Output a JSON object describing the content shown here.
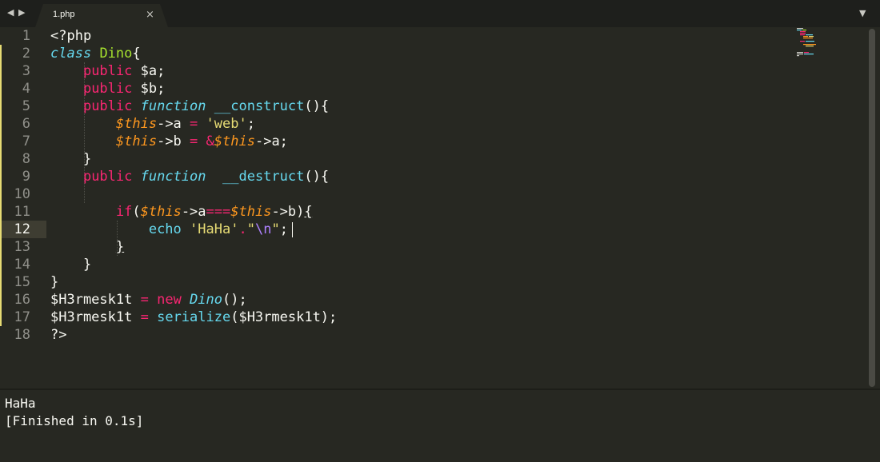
{
  "tabs": [
    {
      "title": "1.php",
      "close": "×"
    }
  ],
  "nav": {
    "back": "◀",
    "forward": "▶",
    "menu": "▼"
  },
  "editor": {
    "line_numbers": [
      "1",
      "2",
      "3",
      "4",
      "5",
      "6",
      "7",
      "8",
      "9",
      "10",
      "11",
      "12",
      "13",
      "14",
      "15",
      "16",
      "17",
      "18"
    ],
    "current_line": 12
  },
  "output": {
    "lines": [
      "HaHa",
      "[Finished in 0.1s]"
    ]
  },
  "colors": {
    "background": "#272822",
    "keyword": "#f92672",
    "storage": "#66d9ef",
    "class_name": "#a6e22e",
    "variable": "#fd971f",
    "string": "#e6db74",
    "escape": "#ae81ff",
    "modified_marker": "#e6db74"
  }
}
